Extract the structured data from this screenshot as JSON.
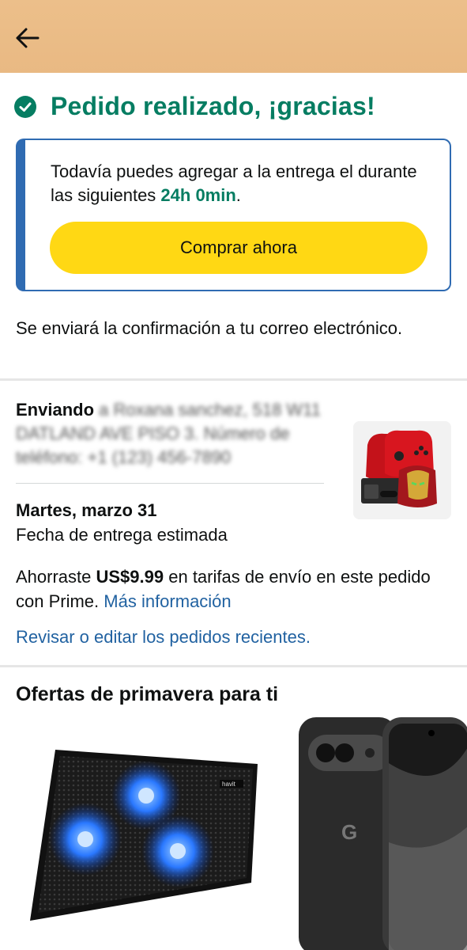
{
  "header": {
    "back_icon": "arrow-left-icon"
  },
  "success": {
    "icon": "check-circle-icon",
    "title": "Pedido realizado, ¡gracias!",
    "color": "#067d62"
  },
  "add_to_delivery": {
    "text_before": "Todavía puedes agregar a la entrega el durante las siguientes ",
    "time": "24h 0min",
    "text_after": ".",
    "button_label": "Comprar ahora",
    "button_color": "#ffd814",
    "border_color": "#2f6bb2"
  },
  "confirmation_text": "Se enviará la confirmación a tu correo electrónico.",
  "shipping": {
    "label": "Enviando",
    "address_blurred": "a Roxana sanchez, 518 W11 DATLAND AVE PISO 3. Número de teléfono: +1 (123) 456-7890"
  },
  "delivery": {
    "date": "Martes, marzo 31",
    "subtitle": "Fecha de entrega estimada"
  },
  "savings": {
    "prefix": "Ahorraste ",
    "amount": "US$9.99",
    "suffix": " en tarifas de envío en este pedido con Prime. ",
    "more_info": "Más información"
  },
  "review_link": "Revisar o editar los pedidos recientes.",
  "offers": {
    "title": "Ofertas de primavera para ti",
    "items": [
      {
        "name": "laptop-cooling-pad",
        "brand": "havit"
      },
      {
        "name": "pixel-phone",
        "logo": "G"
      }
    ]
  },
  "colors": {
    "header_bg": "#ecbf8a",
    "link": "#2162a1"
  }
}
